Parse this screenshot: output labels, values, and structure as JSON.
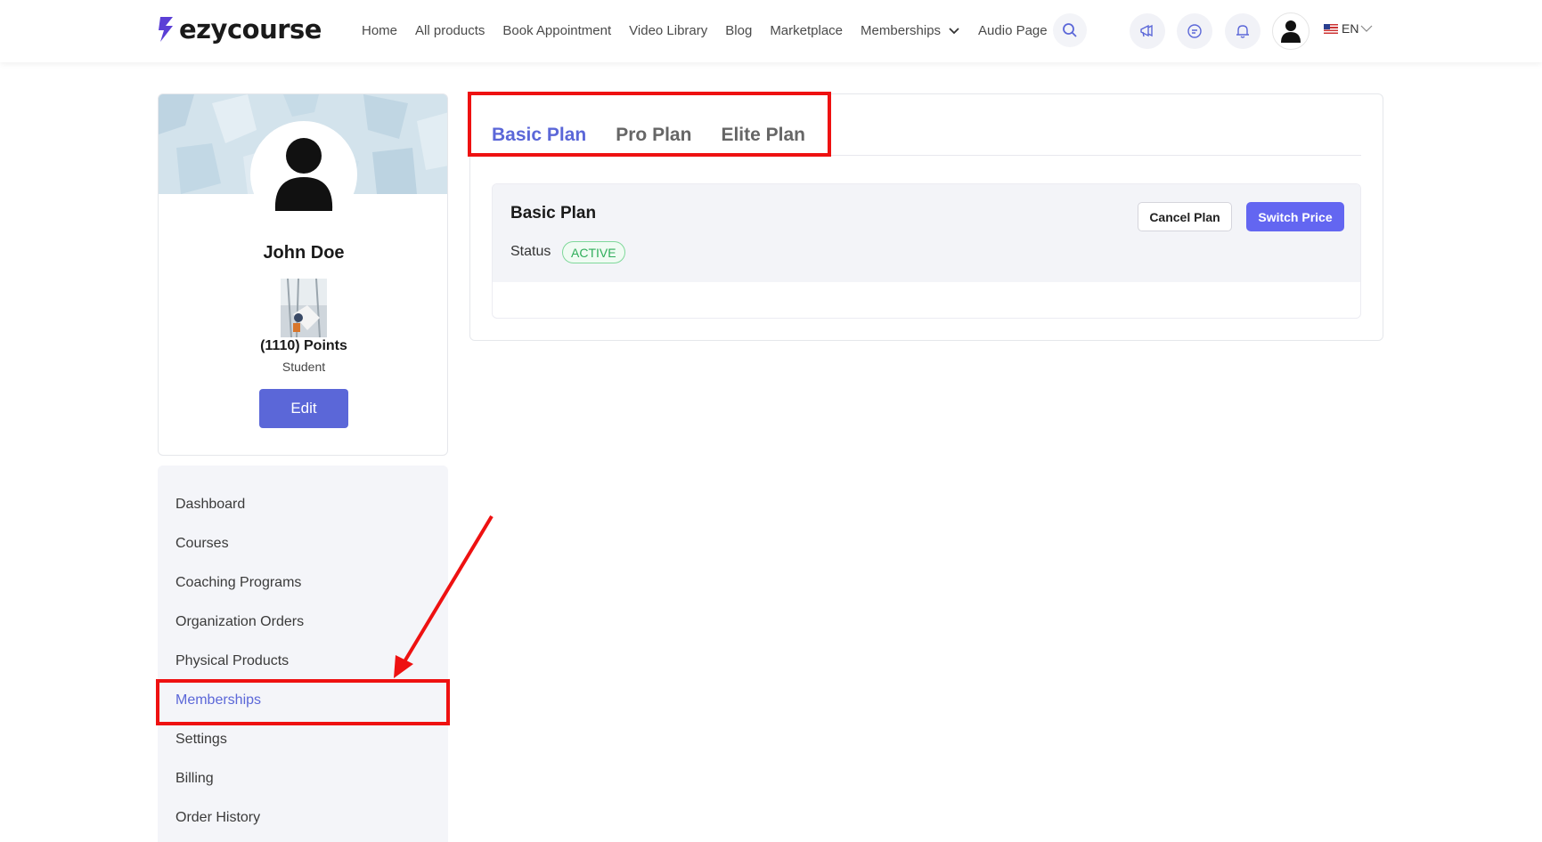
{
  "header": {
    "logo_text": "ezycourse",
    "nav": [
      "Home",
      "All products",
      "Book Appointment",
      "Video Library",
      "Blog",
      "Marketplace",
      "Memberships",
      "Audio Page"
    ],
    "language": "EN",
    "icons": [
      "search-icon",
      "megaphone-icon",
      "chat-icon",
      "bell-icon",
      "user-avatar-icon",
      "us-flag-icon",
      "chevron-down-icon"
    ]
  },
  "profile": {
    "name": "John Doe",
    "points": "(1110) Points",
    "role": "Student",
    "edit_label": "Edit"
  },
  "sidebar": {
    "items": [
      {
        "label": "Dashboard"
      },
      {
        "label": "Courses"
      },
      {
        "label": "Coaching Programs"
      },
      {
        "label": "Organization Orders"
      },
      {
        "label": "Physical Products"
      },
      {
        "label": "Memberships"
      },
      {
        "label": "Settings"
      },
      {
        "label": "Billing"
      },
      {
        "label": "Order History"
      }
    ],
    "active": "Memberships"
  },
  "membership": {
    "tabs": [
      "Basic Plan",
      "Pro Plan",
      "Elite Plan"
    ],
    "active_tab": "Basic Plan",
    "plan": {
      "title": "Basic Plan",
      "status_label": "Status",
      "status_value": "ACTIVE",
      "cancel_label": "Cancel Plan",
      "switch_label": "Switch Price"
    }
  },
  "colors": {
    "accent": "#5b67d8",
    "primary_button": "#6366f1",
    "annotation": "#ee1111",
    "status_active": "#2fae5a"
  }
}
